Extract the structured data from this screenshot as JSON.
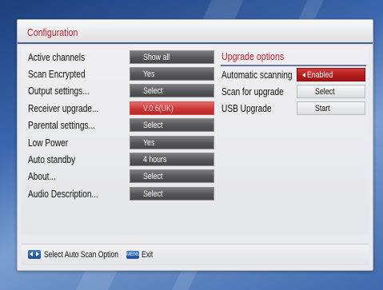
{
  "title": "Configuration",
  "settings": [
    {
      "label": "Active channels",
      "value": "Show all"
    },
    {
      "label": "Scan Encrypted",
      "value": "Yes"
    },
    {
      "label": "Output settings...",
      "value": "Select"
    },
    {
      "label": "Receiver upgrade...",
      "value": "V.0.6(UK)"
    },
    {
      "label": "Parental settings...",
      "value": "Select"
    },
    {
      "label": "Low Power",
      "value": "Yes"
    },
    {
      "label": "Auto standby",
      "value": "4 hours"
    },
    {
      "label": "About...",
      "value": "Select"
    },
    {
      "label": "Audio Description...",
      "value": "Select"
    }
  ],
  "upgrade": {
    "title": "Upgrade options",
    "items": [
      {
        "label": "Automatic scanning",
        "value": "Enabled"
      },
      {
        "label": "Scan for upgrade",
        "value": "Select"
      },
      {
        "label": "USB Upgrade",
        "value": "Start"
      }
    ]
  },
  "footer": {
    "nav_hint": "Select Auto Scan Option",
    "menu_key": "MENU",
    "exit_label": "Exit"
  },
  "colors": {
    "accent_red": "#c0212b",
    "selected_red": "#b21b1b",
    "background_blue": "#3c67ad"
  }
}
